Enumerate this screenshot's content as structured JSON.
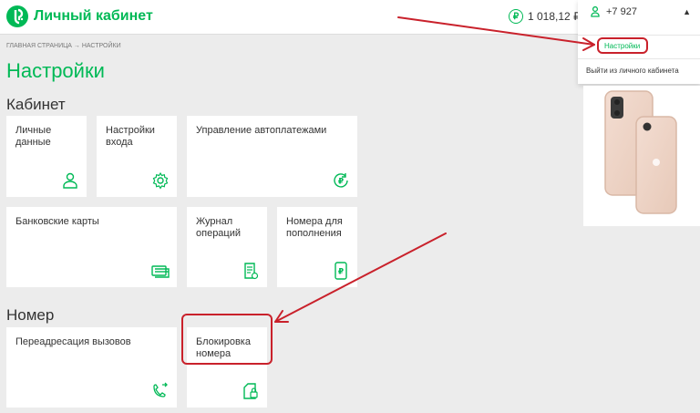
{
  "header": {
    "brand": "Личный кабинет",
    "balance": "1 018,12 ₽"
  },
  "dropdown": {
    "phone": "+7 927",
    "settings": "Настройки",
    "logout": "Выйти из личного кабинета"
  },
  "breadcrumb": "ГЛАВНАЯ СТРАНИЦА → НАСТРОЙКИ",
  "page_title": "Настройки",
  "sections": {
    "cabinet": "Кабинет",
    "number": "Номер"
  },
  "tiles": {
    "personal": "Личные\nданные",
    "login": "Настройки\nвхода",
    "autopay": "Управление автоплатежами",
    "cards": "Банковские карты",
    "journal": "Журнал\nопераций",
    "topup": "Номера для\nпополнения",
    "forward": "Переадресация вызовов",
    "block": "Блокировка\nномера"
  },
  "colors": {
    "accent": "#00b956",
    "annotation": "#c9212b",
    "background": "#ececec"
  },
  "icons": {
    "personal": "user-icon",
    "login": "gear-icon",
    "autopay": "ruble-refresh-icon",
    "cards": "cards-icon",
    "journal": "document-icon",
    "topup": "phone-ruble-icon",
    "forward": "phone-forward-icon",
    "block": "sim-lock-icon"
  }
}
